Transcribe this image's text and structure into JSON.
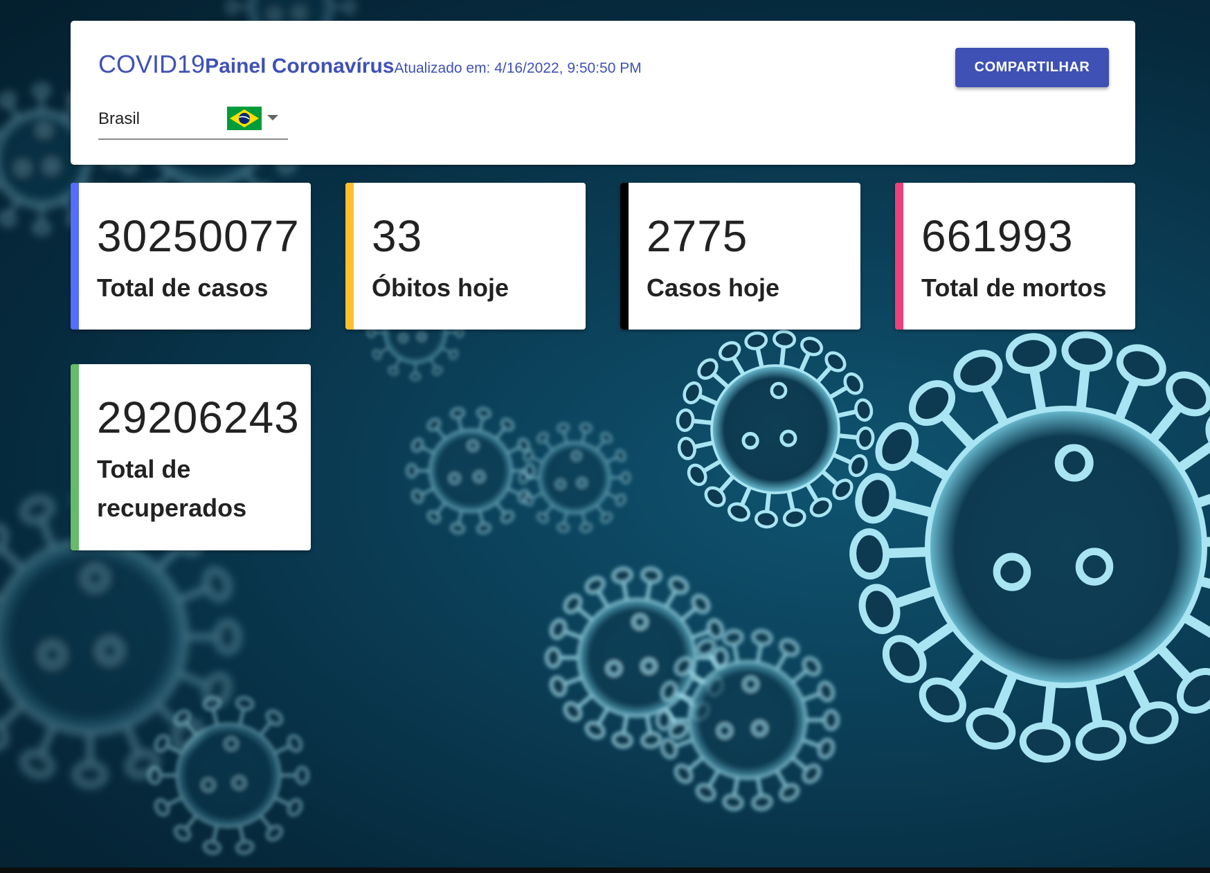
{
  "header": {
    "title_main": "COVID19",
    "title_sub": "Painel Coronavírus",
    "updated_text": "Atualizado em: 4/16/2022, 9:50:50 PM",
    "share_label": "COMPARTILHAR",
    "country": {
      "selected": "Brasil",
      "flag_icon": "brazil-flag-icon"
    }
  },
  "stats": [
    {
      "value": "30250077",
      "label": "Total de casos",
      "color": "#536dfe"
    },
    {
      "value": "33",
      "label": "Óbitos hoje",
      "color": "#fbc02d"
    },
    {
      "value": "2775",
      "label": "Casos hoje",
      "color": "#000000"
    },
    {
      "value": "661993",
      "label": "Total de mortos",
      "color": "#ec407a"
    },
    {
      "value": "29206243",
      "label": "Total de recuperados",
      "color": "#66bb6a"
    }
  ],
  "colors": {
    "primary": "#3f51b5",
    "background": "#0b3f58"
  }
}
